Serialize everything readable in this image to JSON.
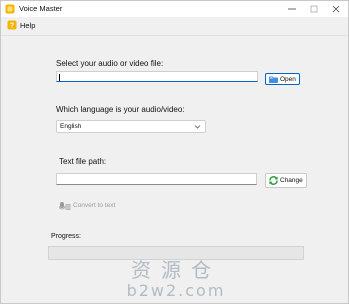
{
  "window": {
    "title": "Voice Master"
  },
  "menu": {
    "help_label": "Help"
  },
  "file_section": {
    "label": "Select your audio or video file:",
    "input_value": "",
    "open_button_label": "Open"
  },
  "language_section": {
    "label": "Which language is your audio/video:",
    "selected_value": "English"
  },
  "output_section": {
    "label": "Text file path:",
    "input_value": "",
    "change_button_label": "Change"
  },
  "convert": {
    "button_label": "Convert to text",
    "enabled": false
  },
  "progress": {
    "label": "Progress:",
    "value": 0
  },
  "watermark": {
    "line1": "资源仓",
    "line2": "b2w2.com"
  },
  "icons": {
    "app": "app-icon",
    "help": "help-icon",
    "open": "folder-icon",
    "change": "refresh-icon",
    "convert": "convert-icon",
    "minimize": "minimize-icon",
    "maximize": "maximize-icon",
    "close": "close-icon",
    "dropdown": "chevron-down-icon"
  },
  "colors": {
    "accent": "#0067c0",
    "change_icon": "#2e9a3a",
    "progress_fill": "#06b025"
  }
}
